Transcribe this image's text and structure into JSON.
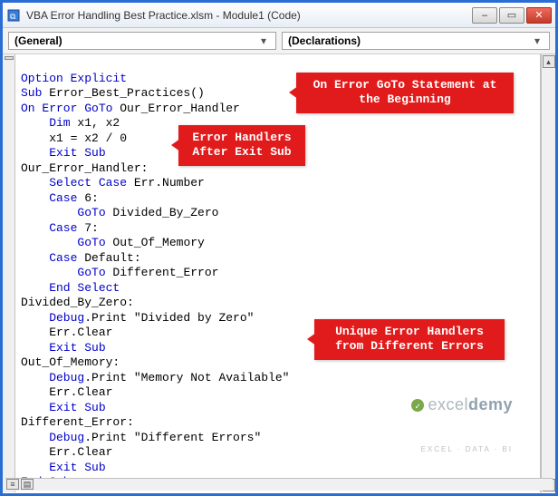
{
  "window": {
    "title": "VBA Error Handling Best Practice.xlsm - Module1 (Code)"
  },
  "dropdowns": {
    "left": "(General)",
    "right": "(Declarations)"
  },
  "code": {
    "l1_a": "Option Explicit",
    "l2_a": "Sub",
    "l2_b": " Error_Best_Practices()",
    "l3_a": "On Error GoTo",
    "l3_b": " Our_Error_Handler",
    "l4_a": "    Dim",
    "l4_b": " x1, x2",
    "l5": "    x1 = x2 / 0",
    "l6_a": "    Exit Sub",
    "l7": "Our_Error_Handler:",
    "l8_a": "    Select Case",
    "l8_b": " Err.Number",
    "l9_a": "    Case",
    "l9_b": " 6:",
    "l10_a": "        GoTo",
    "l10_b": " Divided_By_Zero",
    "l11_a": "    Case",
    "l11_b": " 7:",
    "l12_a": "        GoTo",
    "l12_b": " Out_Of_Memory",
    "l13_a": "    Case",
    "l13_b": " Default:",
    "l14_a": "        GoTo",
    "l14_b": " Different_Error",
    "l15_a": "    End Select",
    "l16": "Divided_By_Zero:",
    "l17_a": "    Debug",
    "l17_b": ".Print \"Divided by Zero\"",
    "l18": "    Err.Clear",
    "l19_a": "    Exit Sub",
    "l20": "Out_Of_Memory:",
    "l21_a": "    Debug",
    "l21_b": ".Print \"Memory Not Available\"",
    "l22": "    Err.Clear",
    "l23_a": "    Exit Sub",
    "l24": "Different_Error:",
    "l25_a": "    Debug",
    "l25_b": ".Print \"Different Errors\"",
    "l26": "    Err.Clear",
    "l27_a": "    Exit Sub",
    "l28_a": "End Sub"
  },
  "callouts": {
    "c1": "On Error GoTo Statement at\nthe Beginning",
    "c2": "Error Handlers\nAfter Exit Sub",
    "c3": "Unique Error Handlers\nfrom Different Errors"
  },
  "watermark": {
    "brand_plain": "excel",
    "brand_bold": "demy",
    "tagline": "EXCEL · DATA · BI"
  }
}
